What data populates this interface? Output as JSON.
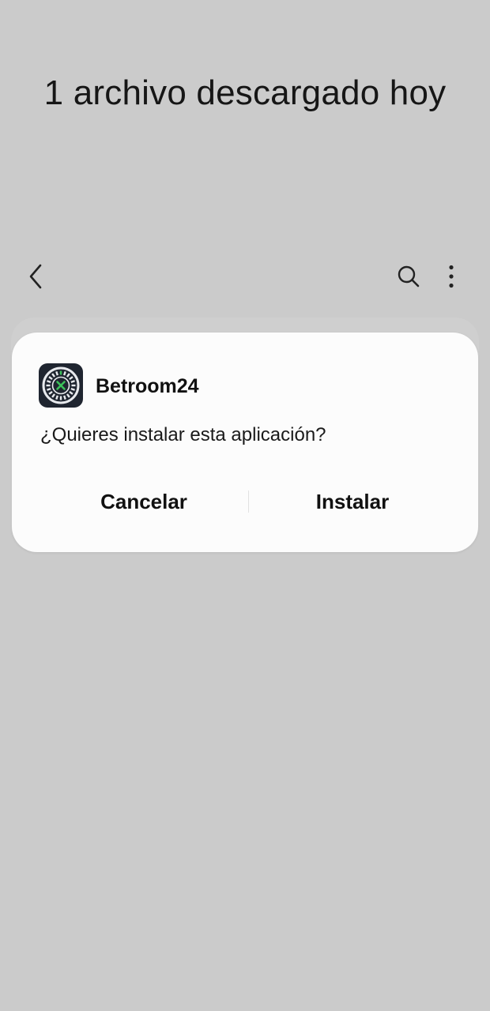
{
  "screen": {
    "title": "1 archivo descargado hoy"
  },
  "toolbar": {
    "back_icon": "chevron-left-icon",
    "search_icon": "search-icon",
    "more_icon": "more-vertical-icon"
  },
  "dialog": {
    "app_name": "Betroom24",
    "app_icon": "roulette-wheel-icon",
    "message": "¿Quieres instalar esta aplicación?",
    "cancel_label": "Cancelar",
    "install_label": "Instalar"
  },
  "colors": {
    "background": "#cbcbcb",
    "dialog": "#fcfcfc",
    "app_icon_bg": "#1f2530",
    "app_icon_accent": "#3cc25a"
  }
}
